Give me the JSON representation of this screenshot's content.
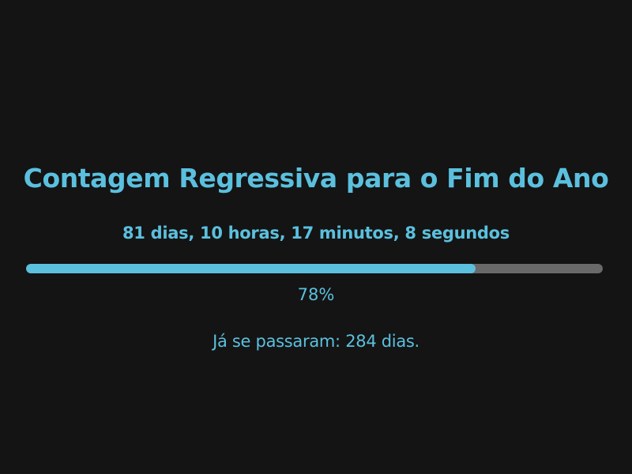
{
  "title": "Contagem Regressiva para o Fim do Ano",
  "countdown": "81 dias, 10 horas, 17 minutos, 8 segundos",
  "progress": {
    "value": 0.78,
    "label": "78%"
  },
  "elapsed": "Já se passaram: 284 dias.",
  "colors": {
    "accent": "#5bc0de",
    "background": "#141414",
    "track": "#696969"
  }
}
